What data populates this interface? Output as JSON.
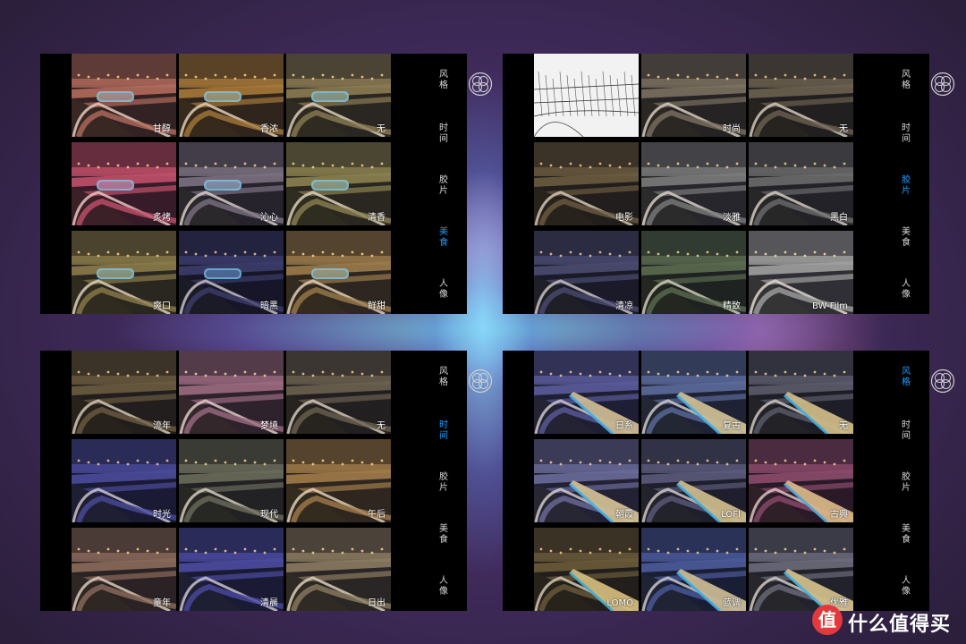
{
  "panels": [
    {
      "tabs": [
        {
          "label": "风格",
          "active": false
        },
        {
          "label": "时间",
          "active": false
        },
        {
          "label": "胶片",
          "active": false
        },
        {
          "label": "美食",
          "active": true
        },
        {
          "label": "人像",
          "active": false
        }
      ],
      "filters": [
        {
          "label": "甘醇",
          "tint": "#b06a5a",
          "scene": "bus"
        },
        {
          "label": "香浓",
          "tint": "#a5783a",
          "scene": "bus"
        },
        {
          "label": "无",
          "tint": "#8a7a52",
          "scene": "bus"
        },
        {
          "label": "炙烤",
          "tint": "#c0506a",
          "scene": "bus"
        },
        {
          "label": "沁心",
          "tint": "#7b7080",
          "scene": "bus"
        },
        {
          "label": "清香",
          "tint": "#8a8050",
          "scene": "bus"
        },
        {
          "label": "爽口",
          "tint": "#8a7a4a",
          "scene": "bus"
        },
        {
          "label": "暗黑",
          "tint": "#3c3c6c",
          "scene": "bus"
        },
        {
          "label": "鲜甜",
          "tint": "#9a7a4a",
          "scene": "bus"
        }
      ]
    },
    {
      "tabs": [
        {
          "label": "风格",
          "active": false
        },
        {
          "label": "时间",
          "active": false
        },
        {
          "label": "胶片",
          "active": true
        },
        {
          "label": "美食",
          "active": false
        },
        {
          "label": "人像",
          "active": false
        }
      ],
      "filters": [
        {
          "label": "",
          "tint": "#e8e8e8",
          "scene": "sketch"
        },
        {
          "label": "时尚",
          "tint": "#7a7060",
          "scene": "road"
        },
        {
          "label": "无",
          "tint": "#6a6050",
          "scene": "road"
        },
        {
          "label": "电影",
          "tint": "#6a5a40",
          "scene": "road"
        },
        {
          "label": "淡雅",
          "tint": "#7a7a7a",
          "scene": "road"
        },
        {
          "label": "黑白",
          "tint": "#6a6a6a",
          "scene": "road"
        },
        {
          "label": "清凉",
          "tint": "#4a4a70",
          "scene": "road"
        },
        {
          "label": "精致",
          "tint": "#5a6a50",
          "scene": "road"
        },
        {
          "label": "BW-Film",
          "tint": "#a0a0a0",
          "scene": "road"
        }
      ]
    },
    {
      "tabs": [
        {
          "label": "风格",
          "active": false
        },
        {
          "label": "时间",
          "active": true
        },
        {
          "label": "胶片",
          "active": false
        },
        {
          "label": "美食",
          "active": false
        },
        {
          "label": "人像",
          "active": false
        }
      ],
      "filters": [
        {
          "label": "流年",
          "tint": "#6a5a40",
          "scene": "road"
        },
        {
          "label": "梦境",
          "tint": "#9a6a80",
          "scene": "road"
        },
        {
          "label": "无",
          "tint": "#6a6050",
          "scene": "road"
        },
        {
          "label": "时光",
          "tint": "#4a4a9a",
          "scene": "road"
        },
        {
          "label": "现代",
          "tint": "#6a6a5a",
          "scene": "road"
        },
        {
          "label": "午后",
          "tint": "#a07a4a",
          "scene": "road"
        },
        {
          "label": "童年",
          "tint": "#8a6a5a",
          "scene": "road"
        },
        {
          "label": "清晨",
          "tint": "#4a4aa0",
          "scene": "road"
        },
        {
          "label": "日出",
          "tint": "#8a7a60",
          "scene": "road"
        }
      ]
    },
    {
      "tabs": [
        {
          "label": "风格",
          "active": true
        },
        {
          "label": "时间",
          "active": false
        },
        {
          "label": "胶片",
          "active": false
        },
        {
          "label": "美食",
          "active": false
        },
        {
          "label": "人像",
          "active": false
        }
      ],
      "filters": [
        {
          "label": "日系",
          "tint": "#5a5a9a",
          "scene": "bridge"
        },
        {
          "label": "复古",
          "tint": "#5a6a9a",
          "scene": "bridge"
        },
        {
          "label": "无",
          "tint": "#5a5a6a",
          "scene": "bridge"
        },
        {
          "label": "朝霞",
          "tint": "#6a6a9a",
          "scene": "bridge"
        },
        {
          "label": "LOFI",
          "tint": "#5a5a7a",
          "scene": "bridge"
        },
        {
          "label": "古典",
          "tint": "#8a4a6a",
          "scene": "bridge"
        },
        {
          "label": "LOMO",
          "tint": "#6a5a3a",
          "scene": "bridge"
        },
        {
          "label": "蓝调",
          "tint": "#4a5a9a",
          "scene": "bridge"
        },
        {
          "label": "优雅",
          "tint": "#6a6a7a",
          "scene": "bridge"
        }
      ]
    }
  ],
  "watermark": {
    "logo": "值",
    "text": "什么值得买"
  }
}
